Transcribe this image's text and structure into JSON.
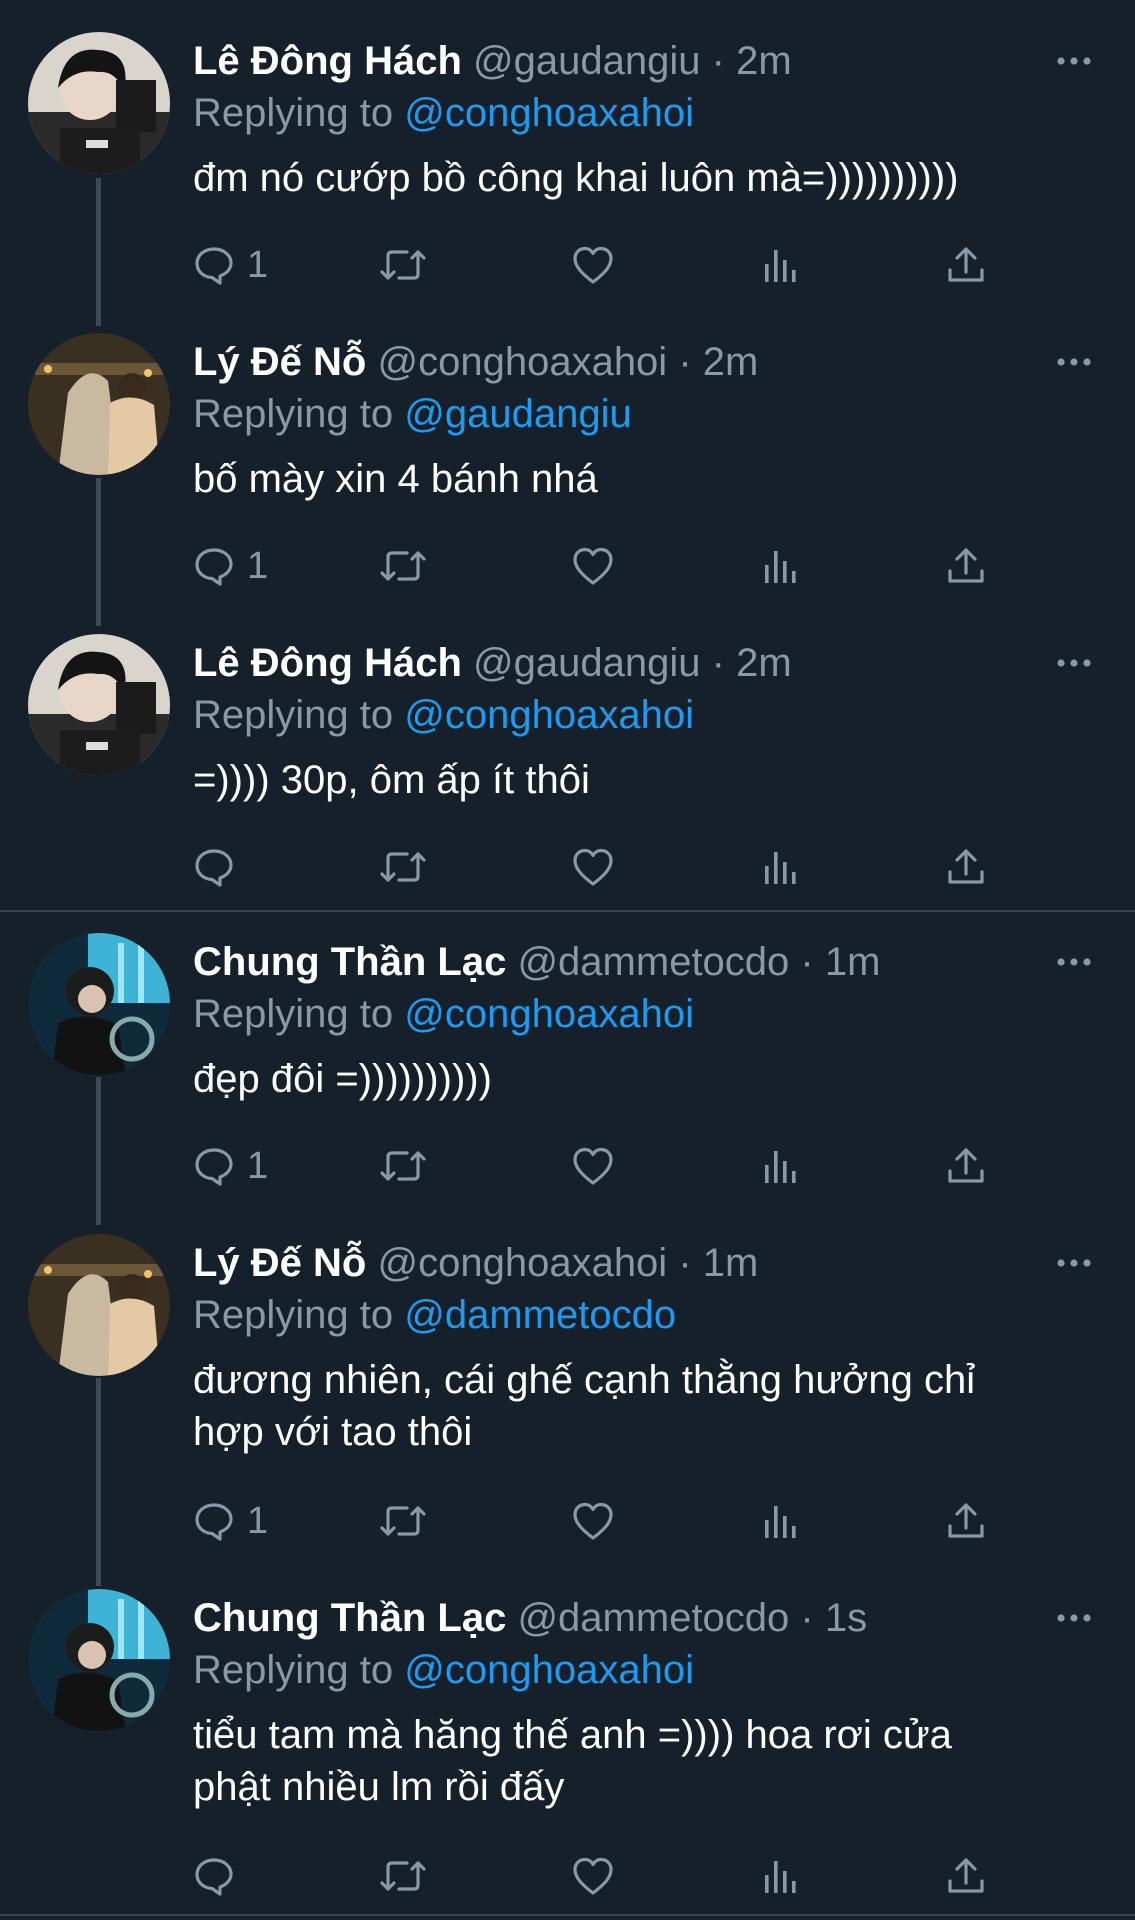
{
  "tweets": [
    {
      "name": "Lê Đông Hách",
      "handle": "@gaudangiu",
      "dot": "·",
      "time": "2m",
      "reply_prefix": "Replying to",
      "reply_mention": "@conghoaxahoi",
      "lines": [
        "đm nó cướp bồ công khai luôn mà=))))))))))"
      ],
      "reply_count": "1",
      "avatar_icon": "avatar-leDongHach"
    },
    {
      "name": "Lý Đế Nỗ",
      "handle": "@conghoaxahoi",
      "dot": "·",
      "time": "2m",
      "reply_prefix": "Replying to",
      "reply_mention": "@gaudangiu",
      "lines": [
        "bố mày xin 4 bánh nhá"
      ],
      "reply_count": "1",
      "avatar_icon": "avatar-lyDeNo"
    },
    {
      "name": "Lê Đông Hách",
      "handle": "@gaudangiu",
      "dot": "·",
      "time": "2m",
      "reply_prefix": "Replying to",
      "reply_mention": "@conghoaxahoi",
      "lines": [
        "=)))) 30p, ôm ấp ít thôi"
      ],
      "reply_count": "",
      "avatar_icon": "avatar-leDongHach"
    },
    {
      "name": "Chung Thần Lạc",
      "handle": "@dammetocdo",
      "dot": "·",
      "time": "1m",
      "reply_prefix": "Replying to",
      "reply_mention": "@conghoaxahoi",
      "lines": [
        "đẹp đôi =))))))))))"
      ],
      "reply_count": "1",
      "avatar_icon": "avatar-chungThanLac"
    },
    {
      "name": "Lý Đế Nỗ",
      "handle": "@conghoaxahoi",
      "dot": "·",
      "time": "1m",
      "reply_prefix": "Replying to",
      "reply_mention": "@dammetocdo",
      "lines": [
        "đương nhiên, cái ghế cạnh thằng hưởng chỉ",
        "hợp với tao thôi"
      ],
      "reply_count": "1",
      "avatar_icon": "avatar-lyDeNo"
    },
    {
      "name": "Chung Thần Lạc",
      "handle": "@dammetocdo",
      "dot": "·",
      "time": "1s",
      "reply_prefix": "Replying to",
      "reply_mention": "@conghoaxahoi",
      "lines": [
        "tiểu tam mà hăng thế anh =)))) hoa rơi cửa",
        "phật nhiều lm rồi đấy"
      ],
      "reply_count": "",
      "avatar_icon": "avatar-chungThanLac"
    }
  ],
  "icons": {
    "reply": "reply-icon",
    "retweet": "retweet-icon",
    "like": "like-icon",
    "views": "views-icon",
    "share": "share-icon",
    "more": "more-icon"
  },
  "colors": {
    "background": "#15202b",
    "text": "#ffffff",
    "secondary": "#8b98a5",
    "mention": "#1d9bf0",
    "divider": "#38444d",
    "thread_line": "#3d4954"
  }
}
